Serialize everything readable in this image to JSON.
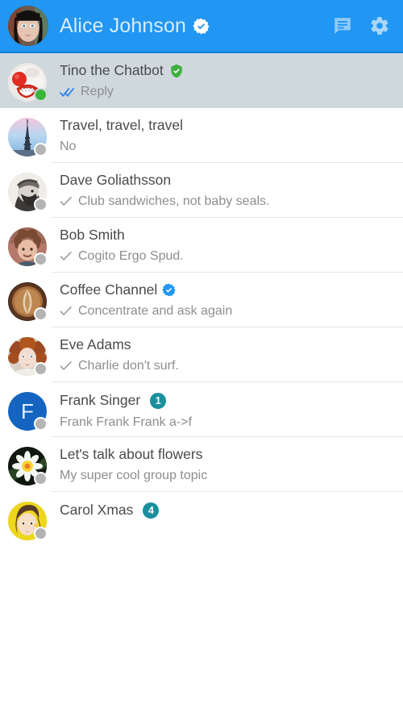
{
  "header": {
    "title": "Alice Johnson",
    "verified": true,
    "avatar_name": "alice-johnson-avatar",
    "actions": [
      {
        "name": "new-chat-icon",
        "label": "New chat"
      },
      {
        "name": "gear-icon",
        "label": "Settings"
      }
    ],
    "background_color": "#2196f3",
    "title_color": "#d9ecfb"
  },
  "colors": {
    "header_blue": "#2196f3",
    "selected_row": "#cfd8dd",
    "badge_teal": "#1a8f9e",
    "verified_blue": "#2196f3",
    "shield_green": "#3fae3f",
    "tick_blue": "#2f80ed",
    "tick_grey": "#9b9b9b",
    "status_grey": "#b4b4b4",
    "status_green": "#3ab63a",
    "title_text": "#4a4a4a",
    "sub_text": "#8e8e8e",
    "divider": "#e6e6e6"
  },
  "list": {
    "items": [
      {
        "title": "Tino the Chatbot",
        "subtitle": "Reply",
        "badge_type": "shield-green",
        "tick": "double-blue",
        "unread": null,
        "selected": true,
        "status": "online",
        "avatar_type": "photo-clown",
        "avatar_letter": ""
      },
      {
        "title": "Travel, travel, travel",
        "subtitle": "No",
        "badge_type": "none",
        "tick": "none",
        "unread": null,
        "selected": false,
        "status": "offline",
        "avatar_type": "photo-eiffel",
        "avatar_letter": ""
      },
      {
        "title": "Dave Goliathsson",
        "subtitle": "Club sandwiches, not baby seals.",
        "badge_type": "none",
        "tick": "single-grey",
        "unread": null,
        "selected": false,
        "status": "offline",
        "avatar_type": "photo-beard",
        "avatar_letter": ""
      },
      {
        "title": "Bob Smith",
        "subtitle": "Cogito Ergo Spud.",
        "badge_type": "none",
        "tick": "single-grey",
        "unread": null,
        "selected": false,
        "status": "offline",
        "avatar_type": "photo-curly",
        "avatar_letter": ""
      },
      {
        "title": "Coffee Channel",
        "subtitle": "Concentrate and ask again",
        "badge_type": "verified-blue",
        "tick": "single-grey",
        "unread": null,
        "selected": false,
        "status": "offline",
        "avatar_type": "photo-latte",
        "avatar_letter": ""
      },
      {
        "title": "Eve Adams",
        "subtitle": "Charlie don't surf.",
        "badge_type": "none",
        "tick": "single-grey",
        "unread": null,
        "selected": false,
        "status": "offline",
        "avatar_type": "photo-redhead",
        "avatar_letter": ""
      },
      {
        "title": "Frank Singer",
        "subtitle": "Frank Frank Frank a->f",
        "badge_type": "none",
        "tick": "none",
        "unread": "1",
        "selected": false,
        "status": "offline",
        "avatar_type": "letter",
        "avatar_letter": "F"
      },
      {
        "title": "Let's talk about flowers",
        "subtitle": "My super cool group topic",
        "badge_type": "none",
        "tick": "none",
        "unread": null,
        "selected": false,
        "status": "offline",
        "avatar_type": "photo-flower",
        "avatar_letter": ""
      },
      {
        "title": "Carol Xmas",
        "subtitle": "",
        "badge_type": "none",
        "tick": "none",
        "unread": "4",
        "selected": false,
        "status": "offline",
        "avatar_type": "photo-carol",
        "avatar_letter": ""
      }
    ]
  }
}
